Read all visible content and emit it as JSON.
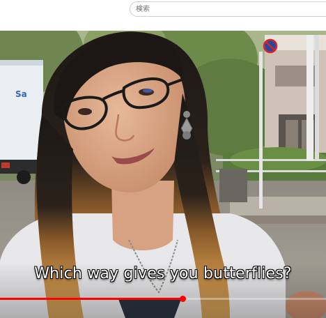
{
  "search": {
    "placeholder": "検索"
  },
  "video": {
    "caption": "Which way gives you butterflies?",
    "progress": 0.56
  },
  "colors": {
    "progress": "#ff0000",
    "caption_text": "#ffffff"
  },
  "icons": [
    "no-parking-sign"
  ]
}
